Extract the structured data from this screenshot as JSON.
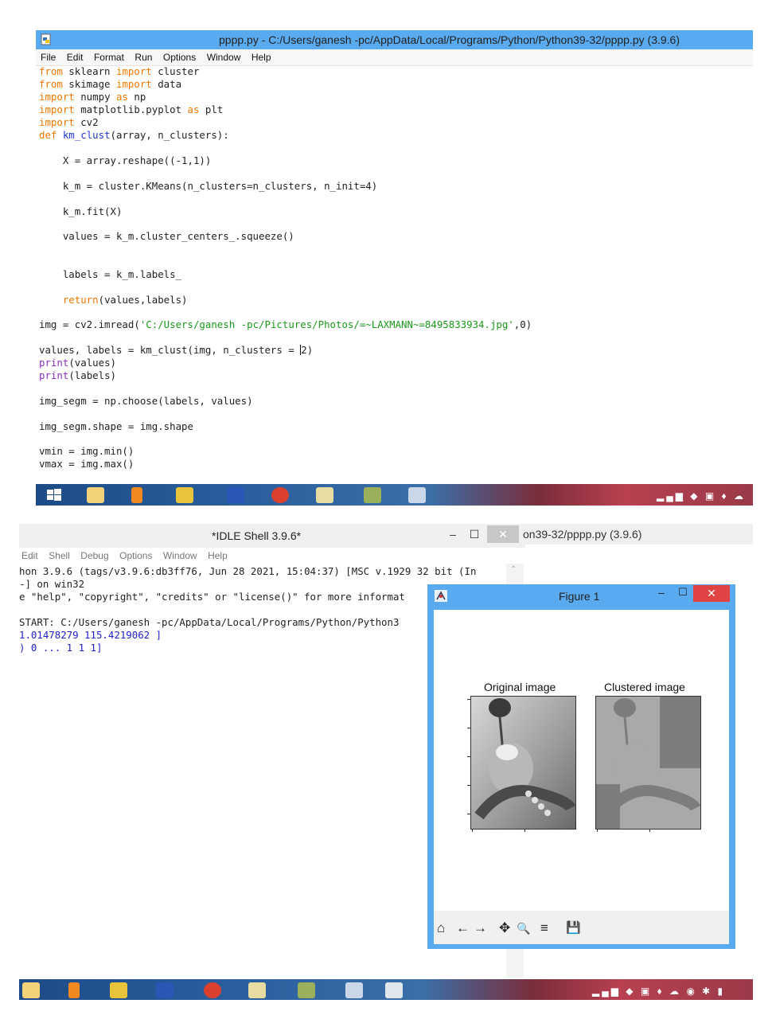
{
  "editor": {
    "title": "pppp.py - C:/Users/ganesh -pc/AppData/Local/Programs/Python/Python39-32/pppp.py (3.9.6)",
    "menu": [
      "File",
      "Edit",
      "Format",
      "Run",
      "Options",
      "Window",
      "Help"
    ],
    "code": {
      "l1_kw": "from",
      "l1_a": " sklearn ",
      "l1_kw2": "import",
      "l1_b": " cluster",
      "l2_kw": "from",
      "l2_a": " skimage ",
      "l2_kw2": "import",
      "l2_b": " data",
      "l3_kw": "import",
      "l3_a": " numpy ",
      "l3_kw2": "as",
      "l3_b": " np",
      "l4_kw": "import",
      "l4_a": " matplotlib.pyplot ",
      "l4_kw2": "as",
      "l4_b": " plt",
      "l5_kw": "import",
      "l5_a": " cv2",
      "l6_kw": "def",
      "l6_fn": " km_clust",
      "l6_a": "(array, n_clusters):",
      "l7": "    X = array.reshape((-1,1))",
      "l8": "    k_m = cluster.KMeans(n_clusters=n_clusters, n_init=4)",
      "l9": "    k_m.fit(X)",
      "l10": "    values = k_m.cluster_centers_.squeeze()",
      "l11": "    labels = k_m.labels_",
      "l12_kw": "    return",
      "l12_a": "(values,labels)",
      "l13_a": "img = cv2.imread(",
      "l13_st": "'C:/Users/ganesh -pc/Pictures/Photos/=~LAXMANN~=8495833934.jpg'",
      "l13_b": ",0)",
      "l14_a": "values, labels = km_clust(img, n_clusters = ",
      "l14_b": "2)",
      "l15_bi": "print",
      "l15_a": "(values)",
      "l16_bi": "print",
      "l16_a": "(labels)",
      "l17": "img_segm = np.choose(labels, values)",
      "l18": "img_segm.shape = img.shape",
      "l19": "vmin = img.min()",
      "l20": "vmax = img.max()"
    }
  },
  "shell": {
    "title": "*IDLE Shell 3.9.6*",
    "menu": [
      "Edit",
      "Shell",
      "Debug",
      "Options",
      "Window",
      "Help"
    ],
    "lines": [
      "hon 3.9.6 (tags/v3.9.6:db3ff76, Jun 28 2021, 15:04:37) [MSC v.1929 32 bit (In",
      "-] on win32",
      "e \"help\", \"copyright\", \"credits\" or \"license()\" for more informat",
      "",
      "START: C:/Users/ganesh -pc/AppData/Local/Programs/Python/Python3"
    ],
    "out1": "1.01478279 115.4219062 ]",
    "out2": ") 0 ... 1 1 1]",
    "min_glyph": "–",
    "max_glyph": "☐",
    "close_glyph": "✕"
  },
  "editor2_title": "on39-32/pppp.py (3.9.6)",
  "figure": {
    "title": "Figure 1",
    "subplot_titles": [
      "Original image",
      "Clustered image"
    ],
    "min_glyph": "–",
    "max_glyph": "☐",
    "close_glyph": "✕",
    "toolbar": [
      {
        "name": "home-icon",
        "glyph": "⌂"
      },
      {
        "name": "back-icon",
        "glyph": "←"
      },
      {
        "name": "forward-icon",
        "glyph": "→"
      },
      {
        "name": "pan-icon",
        "glyph": "✥"
      },
      {
        "name": "zoom-icon",
        "glyph": "🔍"
      },
      {
        "name": "configure-subplots-icon",
        "glyph": "≡"
      },
      {
        "name": "save-icon",
        "glyph": "💾"
      }
    ]
  },
  "colors": {
    "accent": "#5aaaf0",
    "keyword": "#f07800",
    "builtin": "#8a30c8",
    "string": "#1a9a1a",
    "funcname": "#1f38d0",
    "close_red": "#e04343"
  }
}
